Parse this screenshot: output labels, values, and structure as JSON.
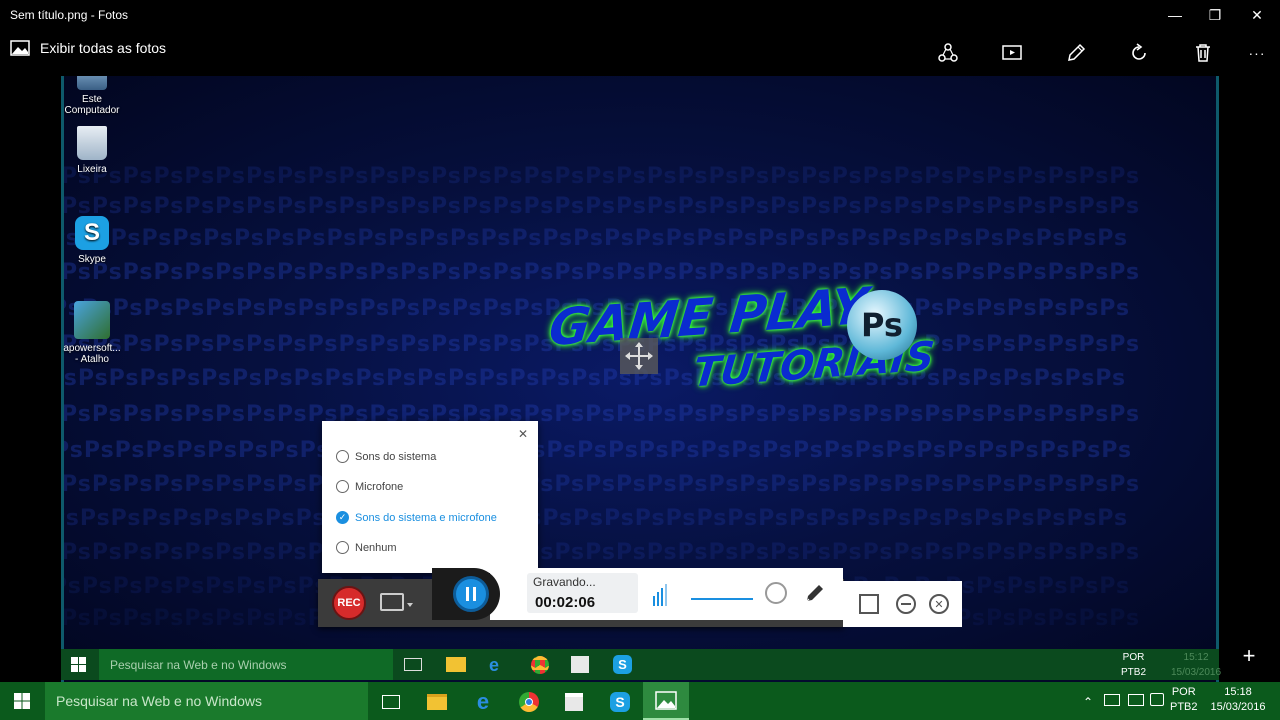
{
  "window": {
    "title": "Sem título.png - Fotos",
    "minimize_icon": "—",
    "maximize_icon": "❐",
    "close_icon": "✕"
  },
  "photos_toolbar": {
    "back_label": "Exibir todas as fotos",
    "more_icon": "···"
  },
  "desktop_icons": [
    {
      "label_line1": "Este",
      "label_line2": "Computador"
    },
    {
      "label_line1": "Lixeira",
      "label_line2": ""
    },
    {
      "label_line1": "Skype",
      "label_line2": ""
    },
    {
      "label_line1": "apowersoft...",
      "label_line2": "- Atalho"
    }
  ],
  "artwork": {
    "line1": "GAME PLAY",
    "line2": "TUTORIAIS",
    "badge": "Ps",
    "pattern_text": "PsPsPsPsPsPsPsPsPsPsPsPsPsPsPsPsPsPsPsPsPsPsPsPsPsPsPsPsPsPsPsPsPsPsPs"
  },
  "audio_popup": {
    "close_icon": "✕",
    "options": [
      {
        "label": "Sons do sistema",
        "selected": false
      },
      {
        "label": "Microfone",
        "selected": false
      },
      {
        "label": "Sons do sistema e microfone",
        "selected": true
      },
      {
        "label": "Nenhum",
        "selected": false
      }
    ]
  },
  "recorder": {
    "rec_label": "REC",
    "status": "Gravando...",
    "timer": "00:02:06"
  },
  "inner_taskbar": {
    "search_placeholder": "Pesquisar na Web e no Windows",
    "lang_top": "POR",
    "lang_bottom": "PTB2",
    "time": "15:12",
    "date": "15/03/2016",
    "plus_icon": "+"
  },
  "taskbar": {
    "search_placeholder": "Pesquisar na Web e no Windows",
    "lang_top": "POR",
    "lang_bottom": "PTB2",
    "time": "15:18",
    "date": "15/03/2016"
  },
  "colors": {
    "taskbar": "#0b5a1c",
    "accent": "#1a8fe0",
    "rec_red": "#d62b2b"
  }
}
